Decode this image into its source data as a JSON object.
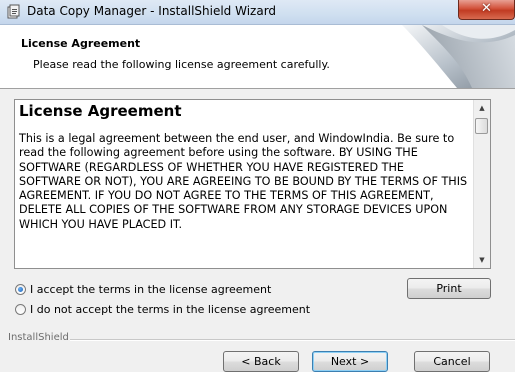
{
  "window": {
    "title": "Data Copy Manager - InstallShield Wizard"
  },
  "header": {
    "title": "License Agreement",
    "subtitle": "Please read the following license agreement carefully."
  },
  "license": {
    "heading": "License Agreement",
    "body": "This is a legal agreement between the end user, and WindowIndia.  Be sure to read the following agreement before using the software.  BY USING THE SOFTWARE (REGARDLESS OF WHETHER YOU HAVE REGISTERED THE SOFTWARE OR NOT), YOU ARE AGREEING TO BE BOUND BY THE TERMS OF THIS AGREEMENT.  IF YOU DO NOT AGREE TO THE TERMS OF THIS AGREEMENT, DELETE ALL COPIES OF THE SOFTWARE FROM ANY STORAGE DEVICES UPON WHICH YOU HAVE PLACED IT."
  },
  "options": {
    "accept_label": "I accept the terms in the license agreement",
    "decline_label": "I do not accept the terms in the license agreement",
    "selected": "accept"
  },
  "buttons": {
    "print": "Print",
    "back": "< Back",
    "next": "Next >",
    "cancel": "Cancel"
  },
  "footer": {
    "brand": "InstallShield"
  },
  "icons": {
    "window": "installer-icon",
    "close": "close-icon",
    "scroll_up": "scroll-up-icon",
    "scroll_down": "scroll-down-icon"
  },
  "colors": {
    "close_button": "#c7422a",
    "radio_selected": "#1a5fb4",
    "default_button_border": "#3c7fb1"
  }
}
